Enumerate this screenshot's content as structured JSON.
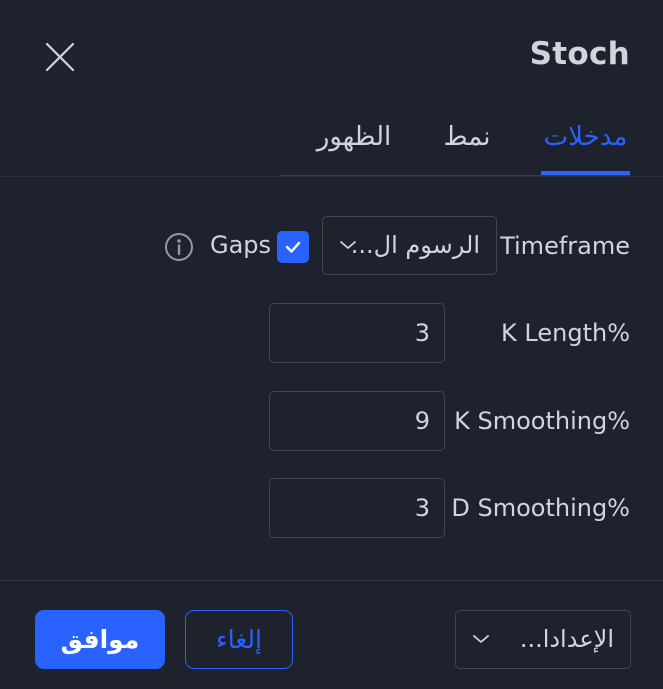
{
  "dialog": {
    "title": "Stoch",
    "close_icon": "close-icon"
  },
  "tabs": [
    {
      "label": "مدخلات",
      "active": true
    },
    {
      "label": "نمط",
      "active": false
    },
    {
      "label": "الظهور",
      "active": false
    }
  ],
  "inputs": {
    "timeframe": {
      "label": "Timeframe",
      "value": "الرسوم ال..."
    },
    "gaps": {
      "label": "Gaps",
      "checked": true
    },
    "k_length": {
      "label": "K Length%",
      "value": "3"
    },
    "k_smoothing": {
      "label": "K Smoothing%",
      "value": "9"
    },
    "d_smoothing": {
      "label": "D Smoothing%",
      "value": "3"
    }
  },
  "footer": {
    "defaults_label": "الإعدادا...",
    "cancel_label": "إلغاء",
    "ok_label": "موافق"
  },
  "colors": {
    "background": "#1e222d",
    "accent": "#2962ff",
    "text": "#d1d4dc",
    "border": "#434651"
  }
}
